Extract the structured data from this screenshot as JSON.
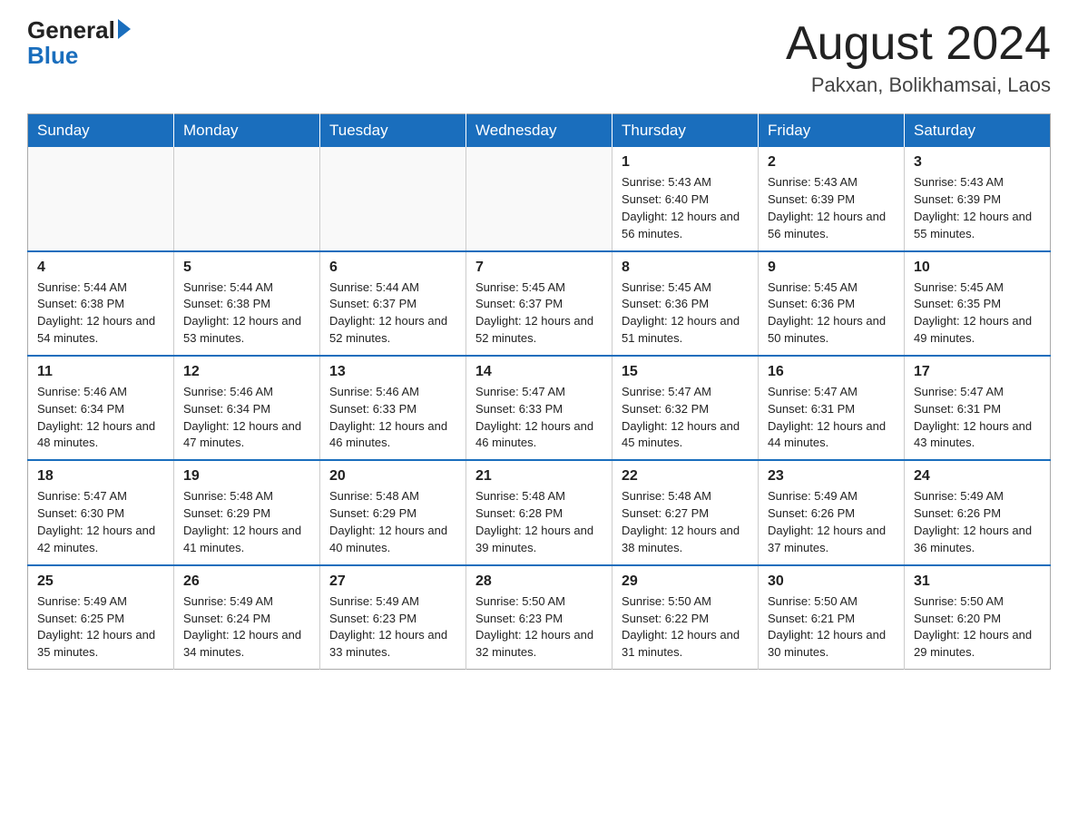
{
  "header": {
    "logo_general": "General",
    "logo_blue": "Blue",
    "month_title": "August 2024",
    "location": "Pakxan, Bolikhamsai, Laos"
  },
  "days_of_week": [
    "Sunday",
    "Monday",
    "Tuesday",
    "Wednesday",
    "Thursday",
    "Friday",
    "Saturday"
  ],
  "weeks": [
    [
      {
        "day": "",
        "sunrise": "",
        "sunset": "",
        "daylight": ""
      },
      {
        "day": "",
        "sunrise": "",
        "sunset": "",
        "daylight": ""
      },
      {
        "day": "",
        "sunrise": "",
        "sunset": "",
        "daylight": ""
      },
      {
        "day": "",
        "sunrise": "",
        "sunset": "",
        "daylight": ""
      },
      {
        "day": "1",
        "sunrise": "Sunrise: 5:43 AM",
        "sunset": "Sunset: 6:40 PM",
        "daylight": "Daylight: 12 hours and 56 minutes."
      },
      {
        "day": "2",
        "sunrise": "Sunrise: 5:43 AM",
        "sunset": "Sunset: 6:39 PM",
        "daylight": "Daylight: 12 hours and 56 minutes."
      },
      {
        "day": "3",
        "sunrise": "Sunrise: 5:43 AM",
        "sunset": "Sunset: 6:39 PM",
        "daylight": "Daylight: 12 hours and 55 minutes."
      }
    ],
    [
      {
        "day": "4",
        "sunrise": "Sunrise: 5:44 AM",
        "sunset": "Sunset: 6:38 PM",
        "daylight": "Daylight: 12 hours and 54 minutes."
      },
      {
        "day": "5",
        "sunrise": "Sunrise: 5:44 AM",
        "sunset": "Sunset: 6:38 PM",
        "daylight": "Daylight: 12 hours and 53 minutes."
      },
      {
        "day": "6",
        "sunrise": "Sunrise: 5:44 AM",
        "sunset": "Sunset: 6:37 PM",
        "daylight": "Daylight: 12 hours and 52 minutes."
      },
      {
        "day": "7",
        "sunrise": "Sunrise: 5:45 AM",
        "sunset": "Sunset: 6:37 PM",
        "daylight": "Daylight: 12 hours and 52 minutes."
      },
      {
        "day": "8",
        "sunrise": "Sunrise: 5:45 AM",
        "sunset": "Sunset: 6:36 PM",
        "daylight": "Daylight: 12 hours and 51 minutes."
      },
      {
        "day": "9",
        "sunrise": "Sunrise: 5:45 AM",
        "sunset": "Sunset: 6:36 PM",
        "daylight": "Daylight: 12 hours and 50 minutes."
      },
      {
        "day": "10",
        "sunrise": "Sunrise: 5:45 AM",
        "sunset": "Sunset: 6:35 PM",
        "daylight": "Daylight: 12 hours and 49 minutes."
      }
    ],
    [
      {
        "day": "11",
        "sunrise": "Sunrise: 5:46 AM",
        "sunset": "Sunset: 6:34 PM",
        "daylight": "Daylight: 12 hours and 48 minutes."
      },
      {
        "day": "12",
        "sunrise": "Sunrise: 5:46 AM",
        "sunset": "Sunset: 6:34 PM",
        "daylight": "Daylight: 12 hours and 47 minutes."
      },
      {
        "day": "13",
        "sunrise": "Sunrise: 5:46 AM",
        "sunset": "Sunset: 6:33 PM",
        "daylight": "Daylight: 12 hours and 46 minutes."
      },
      {
        "day": "14",
        "sunrise": "Sunrise: 5:47 AM",
        "sunset": "Sunset: 6:33 PM",
        "daylight": "Daylight: 12 hours and 46 minutes."
      },
      {
        "day": "15",
        "sunrise": "Sunrise: 5:47 AM",
        "sunset": "Sunset: 6:32 PM",
        "daylight": "Daylight: 12 hours and 45 minutes."
      },
      {
        "day": "16",
        "sunrise": "Sunrise: 5:47 AM",
        "sunset": "Sunset: 6:31 PM",
        "daylight": "Daylight: 12 hours and 44 minutes."
      },
      {
        "day": "17",
        "sunrise": "Sunrise: 5:47 AM",
        "sunset": "Sunset: 6:31 PM",
        "daylight": "Daylight: 12 hours and 43 minutes."
      }
    ],
    [
      {
        "day": "18",
        "sunrise": "Sunrise: 5:47 AM",
        "sunset": "Sunset: 6:30 PM",
        "daylight": "Daylight: 12 hours and 42 minutes."
      },
      {
        "day": "19",
        "sunrise": "Sunrise: 5:48 AM",
        "sunset": "Sunset: 6:29 PM",
        "daylight": "Daylight: 12 hours and 41 minutes."
      },
      {
        "day": "20",
        "sunrise": "Sunrise: 5:48 AM",
        "sunset": "Sunset: 6:29 PM",
        "daylight": "Daylight: 12 hours and 40 minutes."
      },
      {
        "day": "21",
        "sunrise": "Sunrise: 5:48 AM",
        "sunset": "Sunset: 6:28 PM",
        "daylight": "Daylight: 12 hours and 39 minutes."
      },
      {
        "day": "22",
        "sunrise": "Sunrise: 5:48 AM",
        "sunset": "Sunset: 6:27 PM",
        "daylight": "Daylight: 12 hours and 38 minutes."
      },
      {
        "day": "23",
        "sunrise": "Sunrise: 5:49 AM",
        "sunset": "Sunset: 6:26 PM",
        "daylight": "Daylight: 12 hours and 37 minutes."
      },
      {
        "day": "24",
        "sunrise": "Sunrise: 5:49 AM",
        "sunset": "Sunset: 6:26 PM",
        "daylight": "Daylight: 12 hours and 36 minutes."
      }
    ],
    [
      {
        "day": "25",
        "sunrise": "Sunrise: 5:49 AM",
        "sunset": "Sunset: 6:25 PM",
        "daylight": "Daylight: 12 hours and 35 minutes."
      },
      {
        "day": "26",
        "sunrise": "Sunrise: 5:49 AM",
        "sunset": "Sunset: 6:24 PM",
        "daylight": "Daylight: 12 hours and 34 minutes."
      },
      {
        "day": "27",
        "sunrise": "Sunrise: 5:49 AM",
        "sunset": "Sunset: 6:23 PM",
        "daylight": "Daylight: 12 hours and 33 minutes."
      },
      {
        "day": "28",
        "sunrise": "Sunrise: 5:50 AM",
        "sunset": "Sunset: 6:23 PM",
        "daylight": "Daylight: 12 hours and 32 minutes."
      },
      {
        "day": "29",
        "sunrise": "Sunrise: 5:50 AM",
        "sunset": "Sunset: 6:22 PM",
        "daylight": "Daylight: 12 hours and 31 minutes."
      },
      {
        "day": "30",
        "sunrise": "Sunrise: 5:50 AM",
        "sunset": "Sunset: 6:21 PM",
        "daylight": "Daylight: 12 hours and 30 minutes."
      },
      {
        "day": "31",
        "sunrise": "Sunrise: 5:50 AM",
        "sunset": "Sunset: 6:20 PM",
        "daylight": "Daylight: 12 hours and 29 minutes."
      }
    ]
  ]
}
